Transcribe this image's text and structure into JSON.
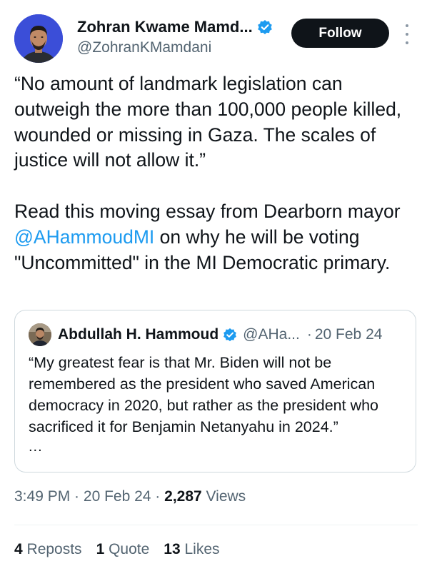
{
  "author": {
    "display_name": "Zohran Kwame Mamd...",
    "handle": "@ZohranKMamdani",
    "avatar_icon": "profile-photo-avatar",
    "verified_icon": "verified-badge-icon",
    "verified_color": "#1d9bf0"
  },
  "follow_button": {
    "label": "Follow"
  },
  "more_icon": "more-vertical-icon",
  "tweet": {
    "paragraph1": "“No amount of landmark legislation can outweigh the more than 100,000 people killed, wounded or missing in Gaza. The scales of justice will not allow it.”",
    "paragraph2_before": "Read this moving essay from Dearborn mayor ",
    "mention": "@AHammoudMI",
    "paragraph2_after": " on why he will be voting \"Uncommitted\" in the MI Democratic primary."
  },
  "quote": {
    "display_name": "Abdullah H. Hammoud",
    "handle": "@AHa...",
    "separator": "·",
    "date": "20 Feb 24",
    "text": "“My greatest fear is that Mr. Biden will not be remembered as the president who saved American democracy in 2020, but rather as the president who sacrificed it for Benjamin Netanyahu in 2024.”",
    "ellipsis": "..."
  },
  "meta": {
    "time": "3:49 PM",
    "sep1": " · ",
    "date": "20 Feb 24",
    "sep2": " · ",
    "views_count": "2,287",
    "views_label": " Views"
  },
  "stats": {
    "reposts_count": "4",
    "reposts_label": " Reposts",
    "quotes_count": "1",
    "quotes_label": " Quote",
    "likes_count": "13",
    "likes_label": " Likes"
  },
  "colors": {
    "text_primary": "#0f1419",
    "text_secondary": "#536471",
    "link": "#1d9bf0",
    "border": "#cfd9de",
    "button_bg": "#0f1419"
  }
}
